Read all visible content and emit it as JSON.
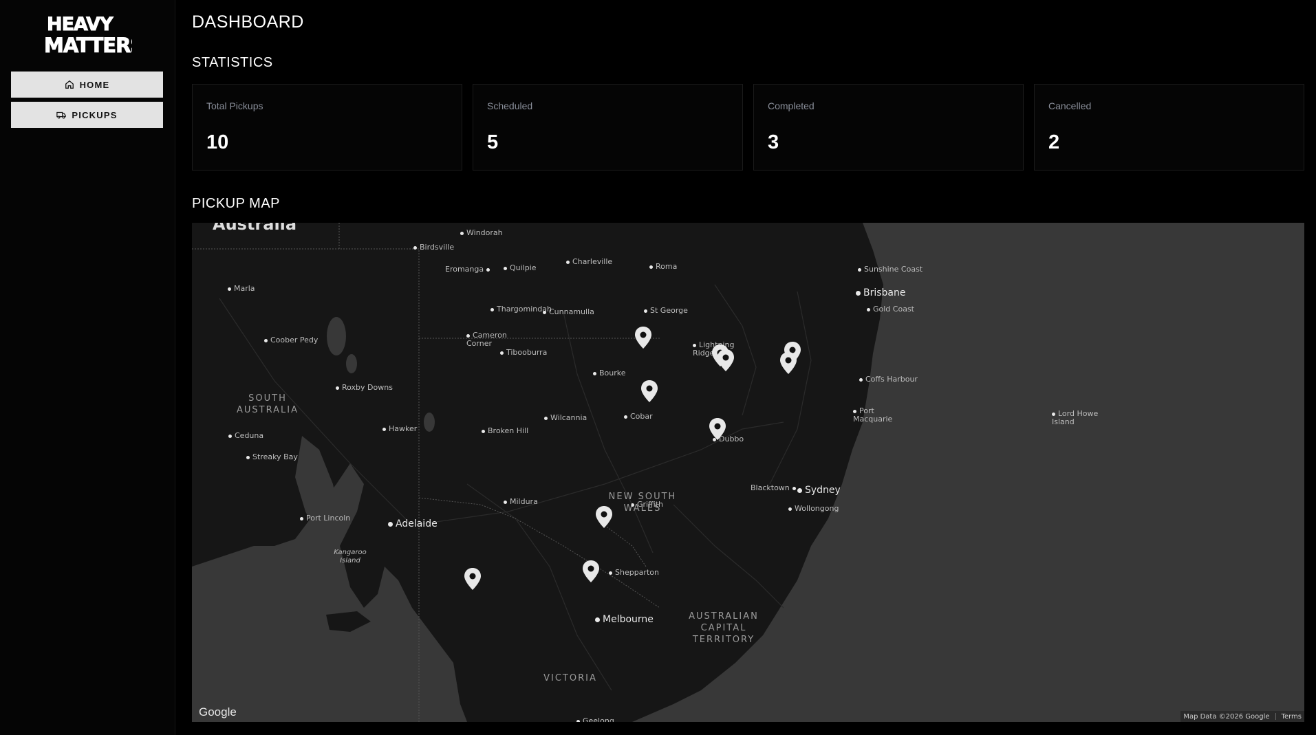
{
  "sidebar": {
    "logo_text": "HEAVY MATTERS",
    "nav": [
      {
        "label": "HOME",
        "icon": "home-icon"
      },
      {
        "label": "PICKUPS",
        "icon": "truck-icon"
      }
    ]
  },
  "header": {
    "title": "DASHBOARD"
  },
  "statistics": {
    "title": "STATISTICS",
    "cards": [
      {
        "label": "Total Pickups",
        "value": "10"
      },
      {
        "label": "Scheduled",
        "value": "5"
      },
      {
        "label": "Completed",
        "value": "3"
      },
      {
        "label": "Cancelled",
        "value": "2"
      }
    ]
  },
  "map": {
    "title": "PICKUP MAP",
    "top_label": "Australia",
    "places": {
      "windorah": "Windorah",
      "birdsville": "Birdsville",
      "eromanga": "Eromanga",
      "quilpie": "Quilpie",
      "charleville": "Charleville",
      "roma": "Roma",
      "sunshine_coast": "Sunshine Coast",
      "brisbane": "Brisbane",
      "gold_coast": "Gold Coast",
      "marla": "Marla",
      "thargomindah": "Thargomindah",
      "cunnamulla": "Cunnamulla",
      "st_george": "St George",
      "coober_pedy": "Coober Pedy",
      "cameron_corner": "Cameron Corner",
      "tibooburra": "Tibooburra",
      "lightning_ridge": "Lightning Ridge",
      "bourke": "Bourke",
      "coffs_harbour": "Coffs Harbour",
      "roxby_downs": "Roxby Downs",
      "port_macquarie": "Port Macquarie",
      "lord_howe": "Lord Howe Island",
      "wilcannia": "Wilcannia",
      "cobar": "Cobar",
      "hawker": "Hawker",
      "ceduna": "Ceduna",
      "broken_hill": "Broken Hill",
      "dubbo": "Dubbo",
      "streaky_bay": "Streaky Bay",
      "blacktown": "Blacktown",
      "sydney": "Sydney",
      "mildura": "Mildura",
      "griffith": "Griffith",
      "wollongong": "Wollongong",
      "port_lincoln": "Port Lincoln",
      "adelaide": "Adelaide",
      "kangaroo_island": "Kangaroo Island",
      "shepparton": "Shepparton",
      "melbourne": "Melbourne",
      "geelong": "Geelong"
    },
    "regions": {
      "sa": "SOUTH AUSTRALIA",
      "nsw": "NEW SOUTH WALES",
      "act": "AUSTRALIAN CAPITAL TERRITORY",
      "vic": "VICTORIA"
    },
    "google": "Google",
    "attribution": "Map Data ©2026 Google",
    "terms": "Terms"
  }
}
